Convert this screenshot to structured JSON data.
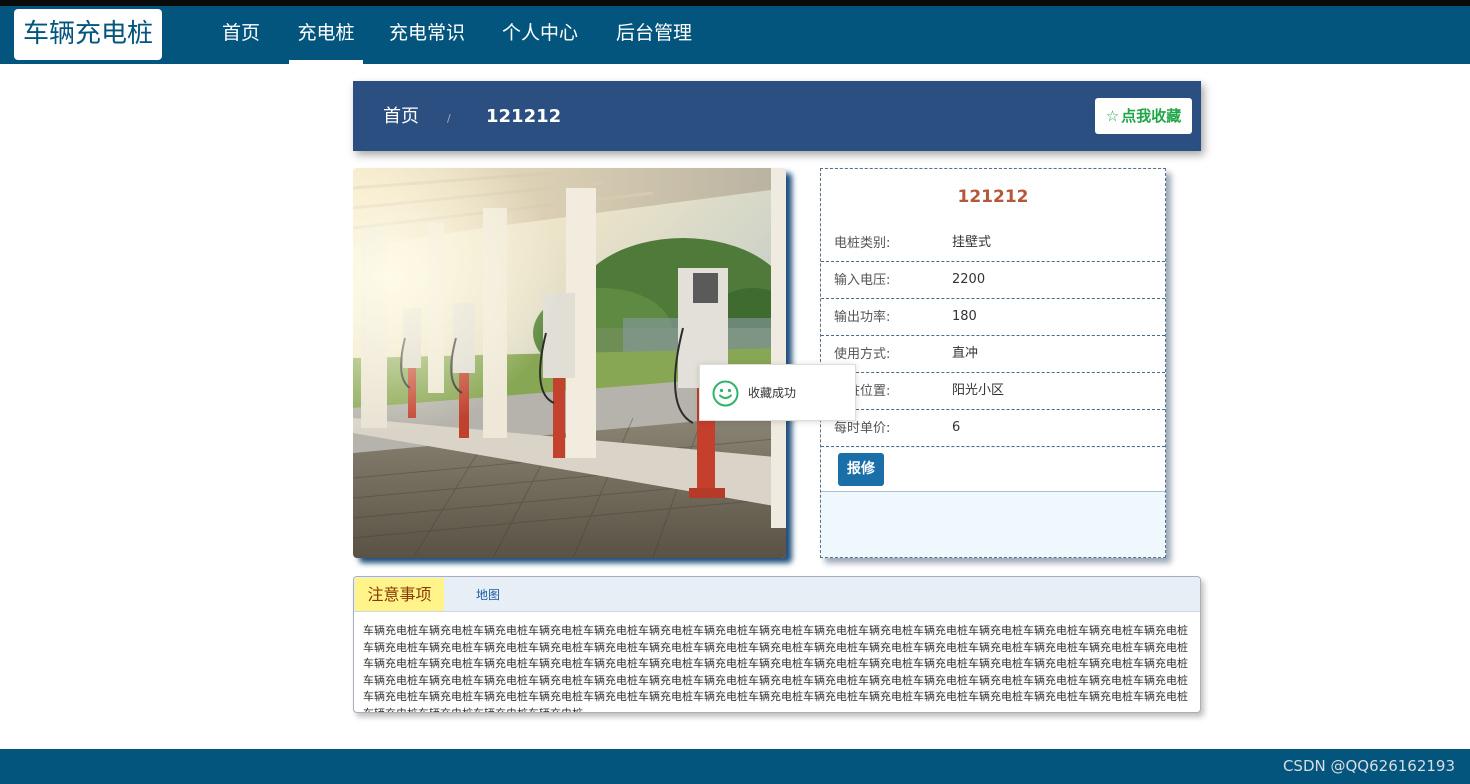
{
  "app": {
    "logo": "车辆充电桩"
  },
  "nav": {
    "items": [
      {
        "label": "首页"
      },
      {
        "label": "充电桩"
      },
      {
        "label": "充电常识"
      },
      {
        "label": "个人中心"
      },
      {
        "label": "后台管理"
      }
    ],
    "active": "充电桩"
  },
  "breadcrumb": {
    "home": "首页",
    "separator": "/",
    "current": "121212"
  },
  "favorite": {
    "icon": "star-outline-icon",
    "label": "点我收藏"
  },
  "detail": {
    "title": "121212",
    "rows": [
      {
        "label": "电桩类别:",
        "value": "挂壁式"
      },
      {
        "label": "输入电压:",
        "value": "2200"
      },
      {
        "label": "输出功率:",
        "value": "180"
      },
      {
        "label": "使用方式:",
        "value": "直冲"
      },
      {
        "label": "电桩位置:",
        "value": "阳光小区"
      },
      {
        "label": "每时单价:",
        "value": "6"
      }
    ],
    "repair_label": "报修"
  },
  "toast": {
    "icon": "smile-icon",
    "message": "收藏成功"
  },
  "tabs": {
    "notes": "注意事项",
    "map": "地图"
  },
  "notes_text": "车辆充电桩车辆充电桩车辆充电桩车辆充电桩车辆充电桩车辆充电桩车辆充电桩车辆充电桩车辆充电桩车辆充电桩车辆充电桩车辆充电桩车辆充电桩车辆充电桩车辆充电桩车辆充电桩车辆充电桩车辆充电桩车辆充电桩车辆充电桩车辆充电桩车辆充电桩车辆充电桩车辆充电桩车辆充电桩车辆充电桩车辆充电桩车辆充电桩车辆充电桩车辆充电桩车辆充电桩车辆充电桩车辆充电桩车辆充电桩车辆充电桩车辆充电桩车辆充电桩车辆充电桩车辆充电桩车辆充电桩车辆充电桩车辆充电桩车辆充电桩车辆充电桩车辆充电桩车辆充电桩车辆充电桩车辆充电桩车辆充电桩车辆充电桩车辆充电桩车辆充电桩车辆充电桩车辆充电桩车辆充电桩车辆充电桩车辆充电桩车辆充电桩车辆充电桩车辆充电桩车辆充电桩车辆充电桩车辆充电桩车辆充电桩车辆充电桩车辆充电桩车辆充电桩车辆充电桩车辆充电桩车辆充电桩车辆充电桩车辆充电桩车辆充电桩车辆充电桩车辆充电桩车辆充电桩车辆充电桩车辆充电桩车辆充电桩",
  "watermark": "CSDN @QQ626162193",
  "colors": {
    "nav_bg": "#03557d",
    "breadcrumb_bg": "#2c4f82",
    "favorite_text": "#22a64a",
    "title": "#b5573a",
    "repair_button": "#1a6fa8",
    "notes_tab": "#fff38a"
  }
}
